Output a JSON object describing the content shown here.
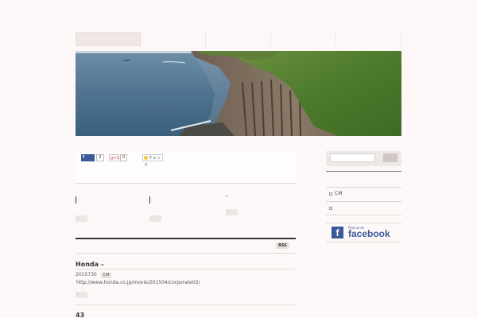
{
  "share": {
    "facebook_label": "f",
    "facebook_count": "2",
    "gplus_label": "g+1",
    "gplus_count": "0",
    "hatena_label": "チェック"
  },
  "related": {
    "dash": "-",
    "btn1": "‹",
    "btn2": "‹",
    "btn3": "‹"
  },
  "feed": {
    "rss_label": "RSS"
  },
  "posts": [
    {
      "title": "Honda –",
      "date": "2015730",
      "category": "CM",
      "link": "http://www.honda.co.jp/movie/201504/corporate02/",
      "more": "‹"
    },
    {
      "title": "43"
    }
  ],
  "sidebar": {
    "items": [
      {
        "label": "CM"
      },
      {
        "label": ""
      }
    ],
    "facebook_small": "Find us on",
    "facebook_big": "facebook",
    "facebook_logo": "f"
  },
  "colors": {
    "background": "#fdf8f7",
    "facebook": "#3b5998"
  }
}
